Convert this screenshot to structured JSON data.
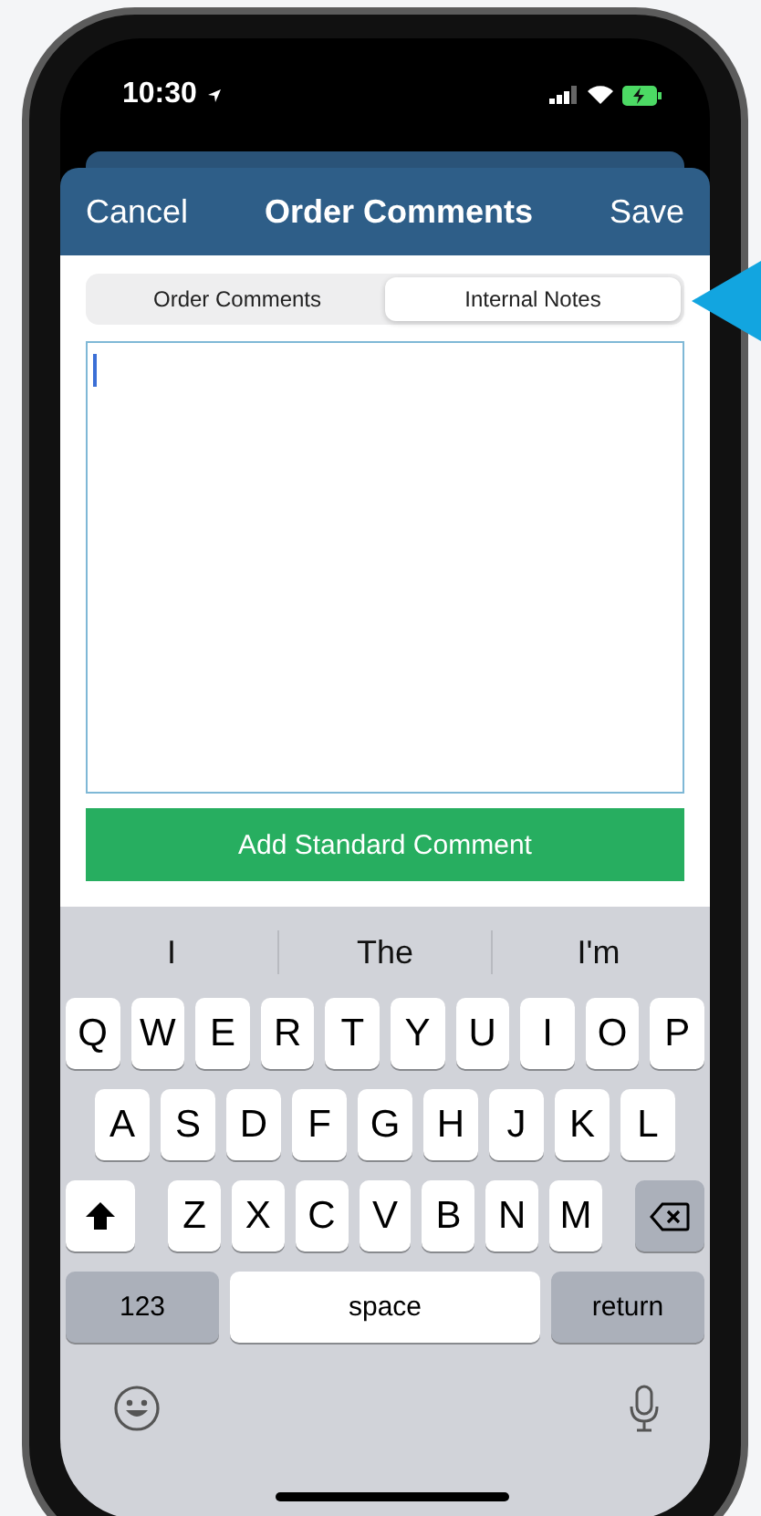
{
  "status_bar": {
    "time": "10:30"
  },
  "header": {
    "cancel": "Cancel",
    "title": "Order Comments",
    "save": "Save"
  },
  "tabs": [
    {
      "label": "Order Comments",
      "selected": false
    },
    {
      "label": "Internal Notes",
      "selected": true
    }
  ],
  "add_button": "Add Standard Comment",
  "keyboard": {
    "suggestions": [
      "I",
      "The",
      "I'm"
    ],
    "rows": [
      [
        "Q",
        "W",
        "E",
        "R",
        "T",
        "Y",
        "U",
        "I",
        "O",
        "P"
      ],
      [
        "A",
        "S",
        "D",
        "F",
        "G",
        "H",
        "J",
        "K",
        "L"
      ],
      [
        "Z",
        "X",
        "C",
        "V",
        "B",
        "N",
        "M"
      ]
    ],
    "numbers_key": "123",
    "space_key": "space",
    "return_key": "return"
  }
}
